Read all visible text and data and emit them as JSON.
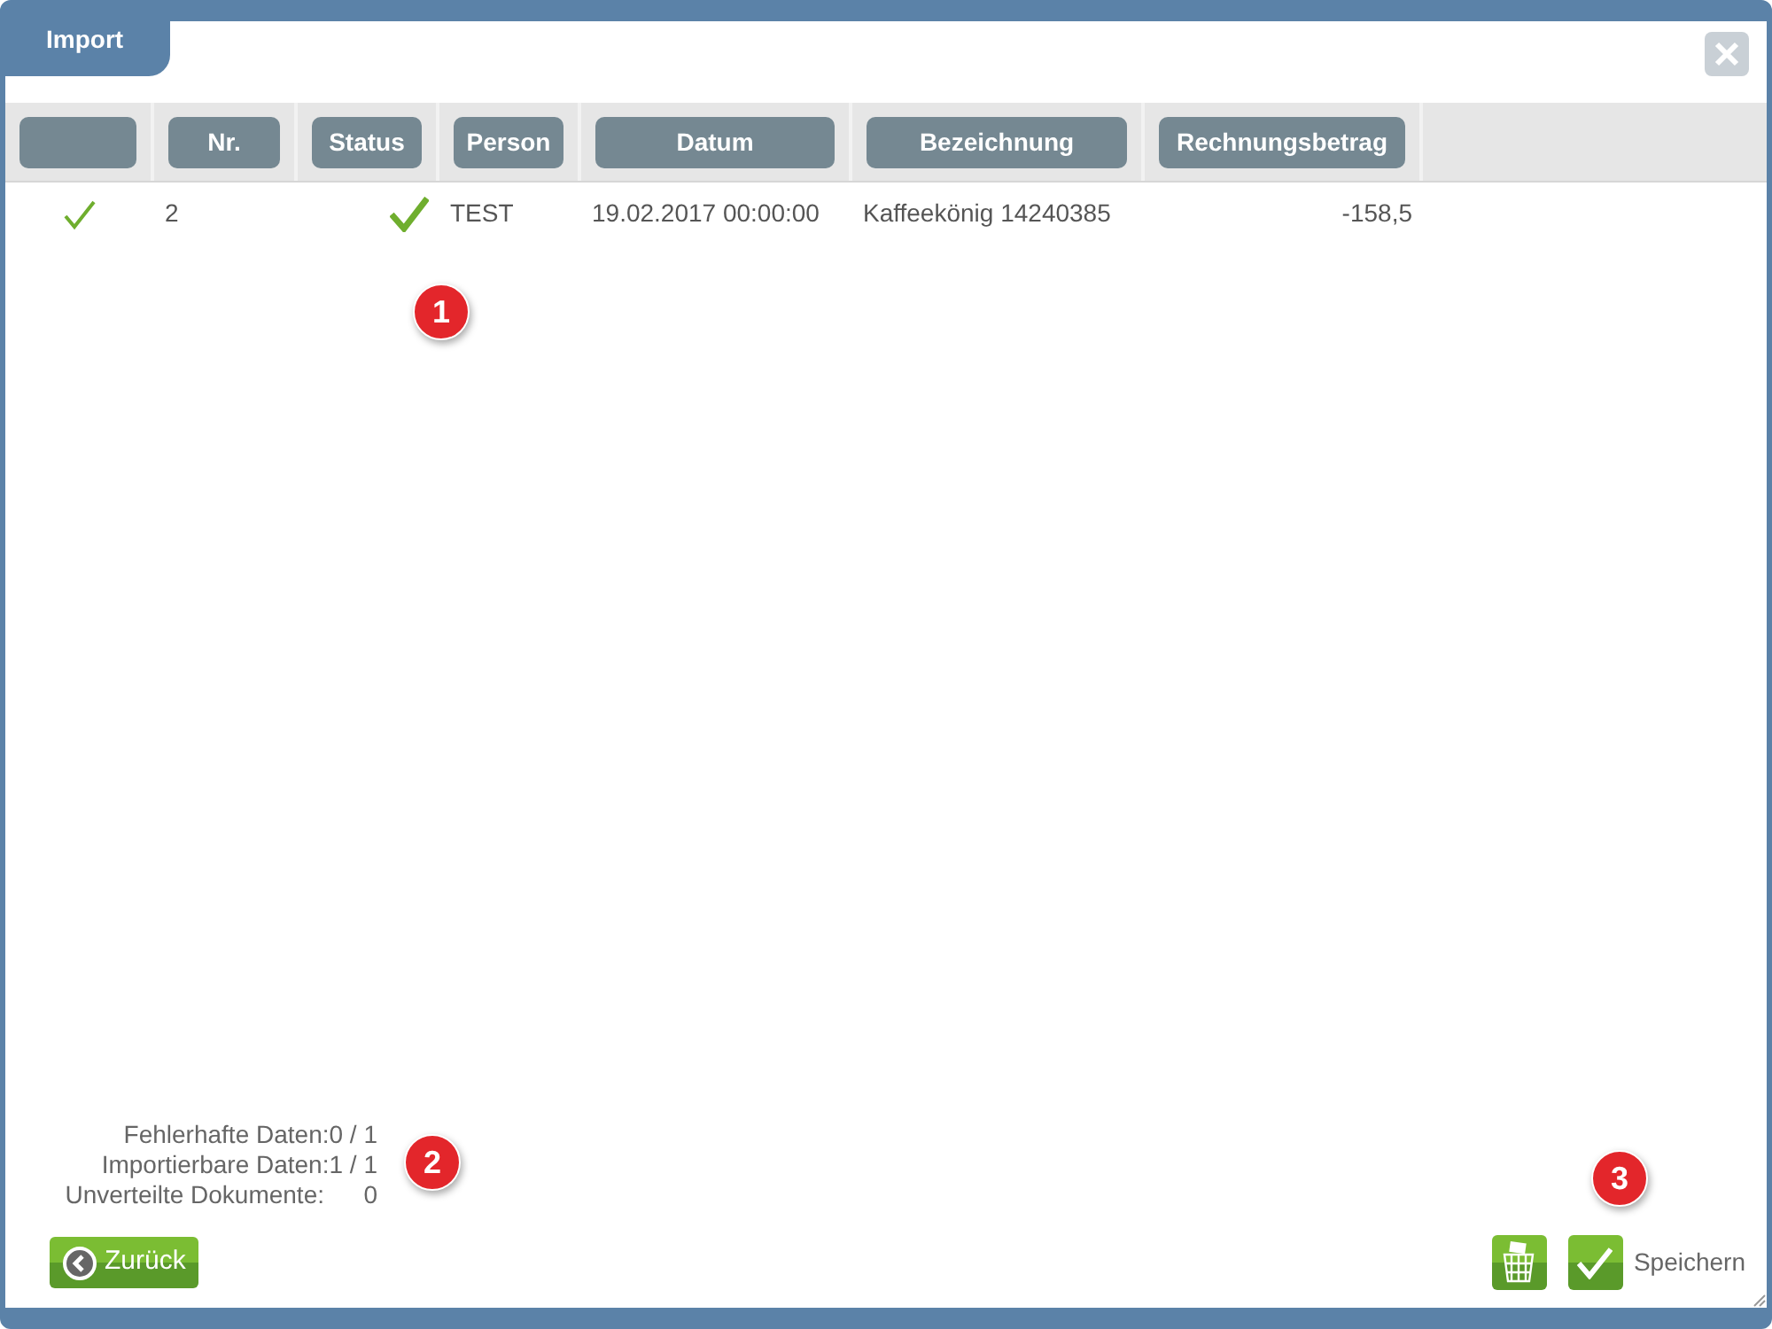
{
  "window": {
    "title": "Import"
  },
  "table": {
    "columns": [
      "",
      "Nr.",
      "Status",
      "Person",
      "Datum",
      "Bezeichnung",
      "Rechnungsbetrag"
    ],
    "rows": [
      {
        "checked": true,
        "nr": "2",
        "status_ok": true,
        "person": "TEST",
        "datum": "19.02.2017 00:00:00",
        "bezeichnung": "Kaffeekönig 14240385",
        "betrag": "-158,5"
      }
    ]
  },
  "summary": [
    {
      "label": "Fehlerhafte Daten:",
      "value": "0 / 1"
    },
    {
      "label": "Importierbare Daten:",
      "value": "1 / 1"
    },
    {
      "label": "Unverteilte Dokumente:",
      "value": "0"
    }
  ],
  "callouts": [
    "1",
    "2",
    "3"
  ],
  "buttons": {
    "back": "Zurück",
    "save": "Speichern"
  }
}
